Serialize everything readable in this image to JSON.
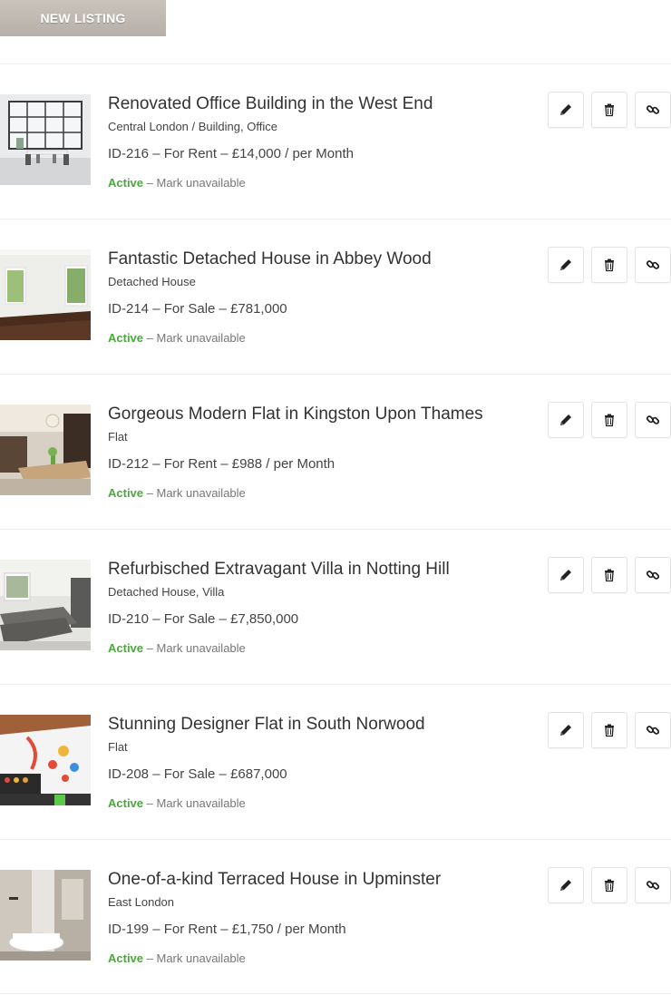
{
  "header": {
    "new_listing_label": "NEW LISTING"
  },
  "listings": [
    {
      "title": "Renovated Office Building in the West End",
      "type": "Central London / Building, Office",
      "meta": "ID-216 – For Rent – £14,000 / per Month",
      "status": "Active",
      "separator": " – ",
      "action_link": "Mark unavailable",
      "image": "office-interior"
    },
    {
      "title": "Fantastic Detached House in Abbey Wood",
      "type": "Detached House",
      "meta": "ID-214 – For Sale – £781,000",
      "status": "Active",
      "separator": " – ",
      "action_link": "Mark unavailable",
      "image": "empty-room"
    },
    {
      "title": "Gorgeous Modern Flat in Kingston Upon Thames",
      "type": "Flat",
      "meta": "ID-212 – For Rent – £988 / per Month",
      "status": "Active",
      "separator": " – ",
      "action_link": "Mark unavailable",
      "image": "dining-room"
    },
    {
      "title": "Refurbisched Extravagant Villa in Notting Hill",
      "type": "Detached House, Villa",
      "meta": "ID-210 – For Sale – £7,850,000",
      "status": "Active",
      "separator": " – ",
      "action_link": "Mark unavailable",
      "image": "living-room"
    },
    {
      "title": "Stunning Designer Flat in South Norwood",
      "type": "Flat",
      "meta": "ID-208 – For Sale – £687,000",
      "status": "Active",
      "separator": " – ",
      "action_link": "Mark unavailable",
      "image": "colorful-lounge"
    },
    {
      "title": "One-of-a-kind Terraced House in Upminster",
      "type": "East London",
      "meta": "ID-199 – For Rent – £1,750 / per Month",
      "status": "Active",
      "separator": " – ",
      "action_link": "Mark unavailable",
      "image": "bathroom"
    }
  ],
  "icons": {
    "edit": "pencil-icon",
    "delete": "trash-icon",
    "link": "link-icon"
  },
  "colors": {
    "active": "#4aa83c",
    "button": "#bdb6af"
  }
}
